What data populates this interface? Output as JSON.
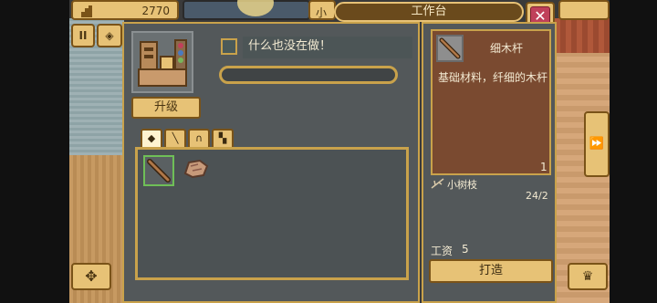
{
  "hud": {
    "coins": "2770",
    "location_label": "小",
    "title": "工作台"
  },
  "buttons": {
    "close": "✕",
    "pause": "II",
    "map": "◈",
    "dpad": "✥",
    "fast_forward": "⏩",
    "crown": "♛"
  },
  "workbench": {
    "status_text": "什么也没在做！",
    "upgrade_label": "升级",
    "progress": 0,
    "tabs": [
      {
        "name": "materials",
        "glyph": "◆",
        "active": true
      },
      {
        "name": "tools",
        "glyph": "╲",
        "active": false
      },
      {
        "name": "helmets",
        "glyph": "∩",
        "active": false
      },
      {
        "name": "armor",
        "glyph": "▚",
        "active": false
      }
    ]
  },
  "detail": {
    "item_name": "细木杆",
    "item_desc": "基础材料，纤细的木杆",
    "item_count": "1",
    "ingredient": {
      "name": "小树枝",
      "qty": "24/2"
    },
    "wage_label": "工资",
    "wage_value": "5",
    "craft_label": "打造"
  },
  "colors": {
    "gold": "#e7c276",
    "panel": "#53585a",
    "item_card": "#7a4a30",
    "progress_fill": "#77b55a"
  }
}
